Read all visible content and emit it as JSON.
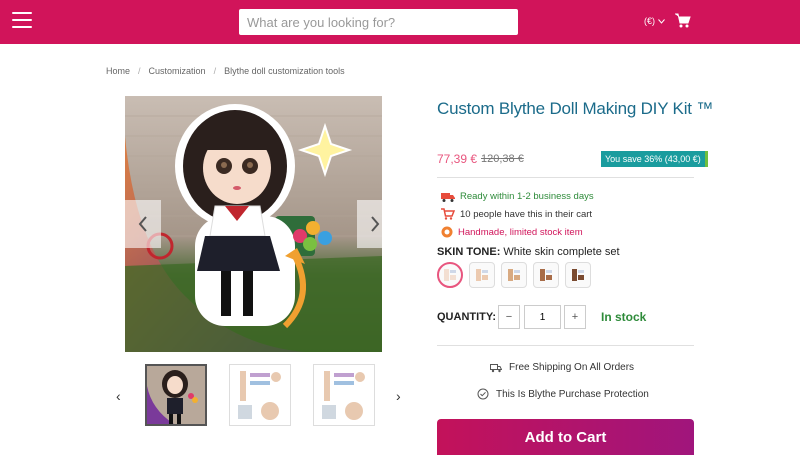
{
  "header": {
    "search_placeholder": "What are you looking for?",
    "currency": "(€)"
  },
  "breadcrumb": [
    "Home",
    "Customization",
    "Blythe doll customization tools"
  ],
  "breadcrumb_sep": "/",
  "product": {
    "title": "Custom Blythe Doll Making DIY Kit ™",
    "price": "77,39 €",
    "old_price": "120,38 €",
    "save": "You save 36% (43,00 €)",
    "info": [
      {
        "icon": "truck-icon",
        "text": "Ready within 1-2 business days",
        "color": "#2e8b3a"
      },
      {
        "icon": "cart-icon",
        "text": "10 people have this in their cart",
        "color": "#333333"
      },
      {
        "icon": "badge-icon",
        "text": "Handmade, limited stock item",
        "color": "#d1145a"
      }
    ],
    "skin_tone_label": "SKIN TONE:",
    "skin_tone_value": "White skin complete set",
    "skin_swatches": [
      "white",
      "natural",
      "tan",
      "brown",
      "dark"
    ],
    "quantity_label": "QUANTITY:",
    "quantity_minus": "−",
    "quantity_value": "1",
    "quantity_plus": "+",
    "stock": "In stock",
    "features": [
      "Free Shipping On All Orders",
      "This Is Blythe Purchase Protection"
    ],
    "add_to_cart": "Add to Cart"
  },
  "gallery": {
    "prev": "‹",
    "next": "›"
  },
  "colors": {
    "brand": "#d1145a",
    "title": "#1b6b8a",
    "price": "#e8557e",
    "save_badge": "#1a9c9e",
    "stock": "#2e8b3a"
  }
}
